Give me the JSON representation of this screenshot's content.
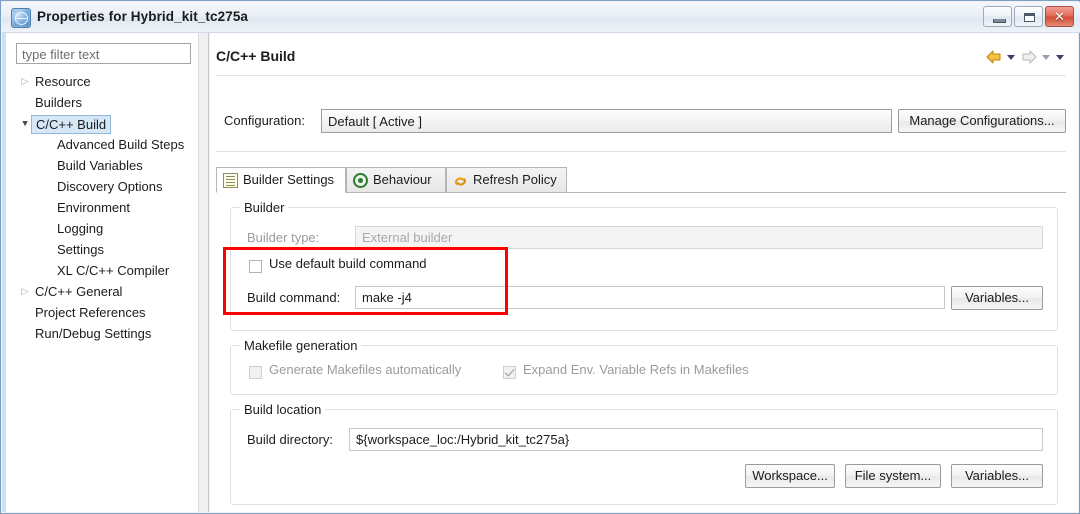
{
  "window": {
    "title": "Properties for Hybrid_kit_tc275a",
    "icon": "properties-globe-icon",
    "controls": {
      "minimize": "Minimize",
      "maximize": "Maximize",
      "close": "Close"
    }
  },
  "sidebar": {
    "filter_placeholder": "type filter text",
    "filter_value": "",
    "items": [
      {
        "label": "Resource",
        "level": 1,
        "twisty": "collapsed",
        "selected": false
      },
      {
        "label": "Builders",
        "level": 1,
        "twisty": "none",
        "selected": false
      },
      {
        "label": "C/C++ Build",
        "level": 1,
        "twisty": "expanded",
        "selected": true
      },
      {
        "label": "Advanced Build Steps",
        "level": 2,
        "twisty": "none",
        "selected": false
      },
      {
        "label": "Build Variables",
        "level": 2,
        "twisty": "none",
        "selected": false
      },
      {
        "label": "Discovery Options",
        "level": 2,
        "twisty": "none",
        "selected": false
      },
      {
        "label": "Environment",
        "level": 2,
        "twisty": "none",
        "selected": false
      },
      {
        "label": "Logging",
        "level": 2,
        "twisty": "none",
        "selected": false
      },
      {
        "label": "Settings",
        "level": 2,
        "twisty": "none",
        "selected": false
      },
      {
        "label": "XL C/C++ Compiler",
        "level": 2,
        "twisty": "none",
        "selected": false
      },
      {
        "label": "C/C++ General",
        "level": 1,
        "twisty": "collapsed",
        "selected": false
      },
      {
        "label": "Project References",
        "level": 1,
        "twisty": "none",
        "selected": false
      },
      {
        "label": "Run/Debug Settings",
        "level": 1,
        "twisty": "none",
        "selected": false
      }
    ]
  },
  "page": {
    "title": "C/C++ Build",
    "nav": {
      "back_icon": "back-arrow-icon",
      "back_menu_icon": "chevron-down-icon",
      "forward_icon": "forward-arrow-icon",
      "forward_menu_icon": "chevron-down-icon",
      "view_menu_icon": "chevron-down-icon"
    },
    "configuration": {
      "label": "Configuration:",
      "value": "Default  [ Active ]",
      "manage_button": "Manage Configurations..."
    },
    "tabs": [
      {
        "label": "Builder Settings",
        "icon": "builder-settings-icon",
        "active": true
      },
      {
        "label": "Behaviour",
        "icon": "behaviour-radio-icon",
        "active": false
      },
      {
        "label": "Refresh Policy",
        "icon": "refresh-policy-icon",
        "active": false
      }
    ],
    "builder_group": {
      "title": "Builder",
      "builder_type_label": "Builder type:",
      "builder_type_value": "External builder",
      "builder_type_disabled": true,
      "use_default_build_command_label": "Use default build command",
      "use_default_build_command_checked": false,
      "build_command_label": "Build command:",
      "build_command_value": "make -j4",
      "variables_button": "Variables..."
    },
    "makefile_group": {
      "title": "Makefile generation",
      "generate_makefiles_label": "Generate Makefiles automatically",
      "generate_makefiles_checked": false,
      "generate_makefiles_disabled": true,
      "expand_env_label": "Expand Env. Variable Refs in Makefiles",
      "expand_env_checked": true,
      "expand_env_disabled": true
    },
    "build_location_group": {
      "title": "Build location",
      "build_directory_label": "Build directory:",
      "build_directory_value": "${workspace_loc:/Hybrid_kit_tc275a}",
      "workspace_button": "Workspace...",
      "file_system_button": "File system...",
      "variables_button": "Variables..."
    }
  },
  "annotation": {
    "highlight_color": "#ff0000",
    "target": "use-default-build-command and build-command rows"
  }
}
